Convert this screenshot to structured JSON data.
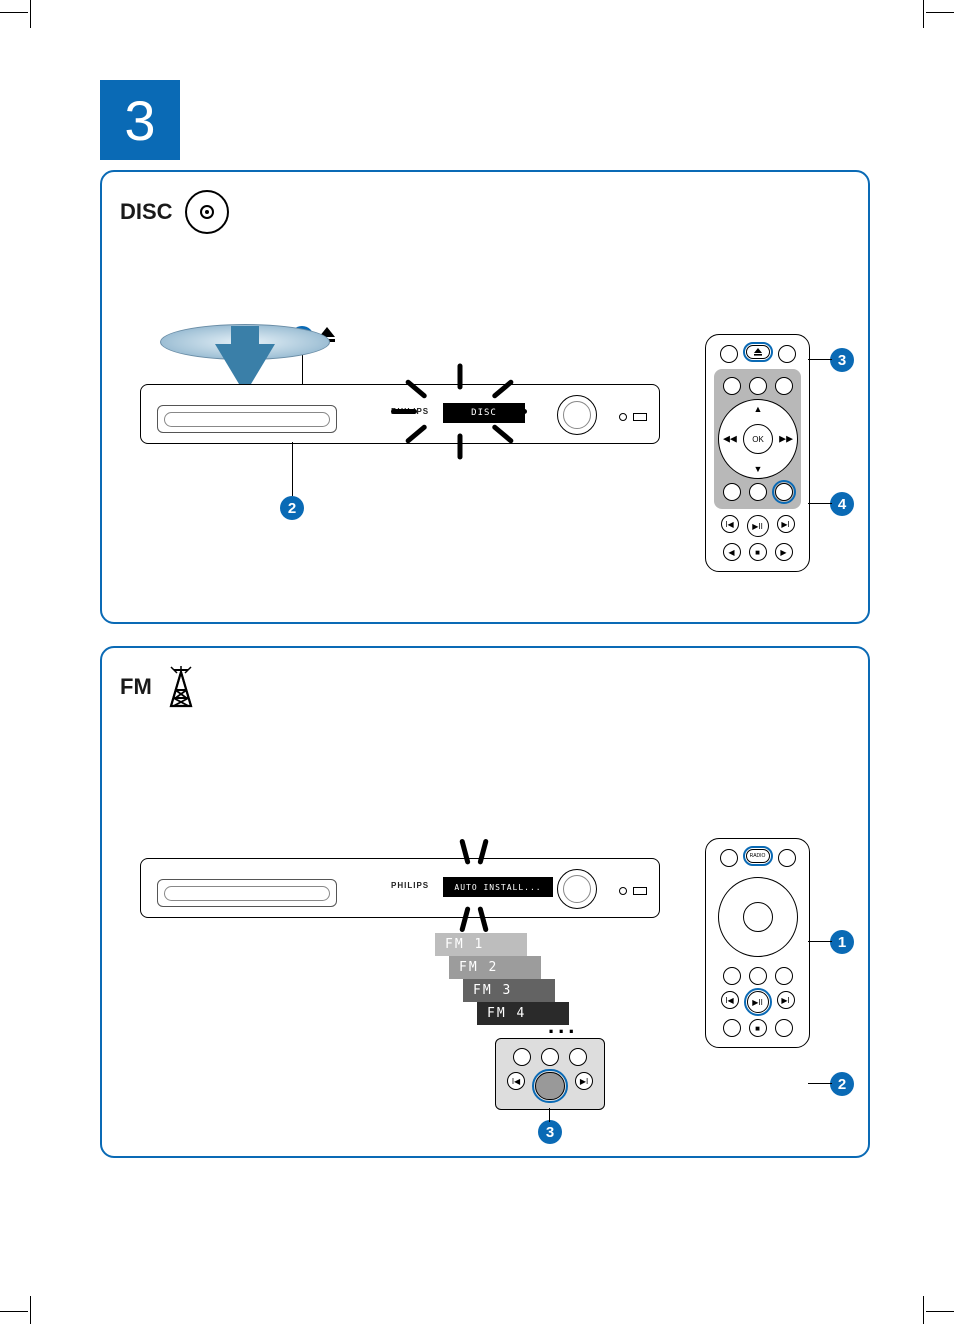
{
  "step_number": "3",
  "panel_disc": {
    "title": "DISC",
    "brand": "PHILIPS",
    "display_text": "DISC",
    "remote_ok": "OK",
    "callouts": [
      "1",
      "2",
      "3",
      "4"
    ]
  },
  "panel_fm": {
    "title": "FM",
    "brand": "PHILIPS",
    "display_text": "AUTO INSTALL...",
    "stations": [
      {
        "label": "FM 1",
        "shade": "#bdbdbd"
      },
      {
        "label": "FM 2",
        "shade": "#9c9c9c"
      },
      {
        "label": "FM 3",
        "shade": "#636363"
      },
      {
        "label": "FM 4",
        "shade": "#2a2a2a"
      }
    ],
    "dots": "...",
    "remote_radio_label": "RADIO",
    "callouts": [
      "1",
      "2",
      "3"
    ]
  }
}
